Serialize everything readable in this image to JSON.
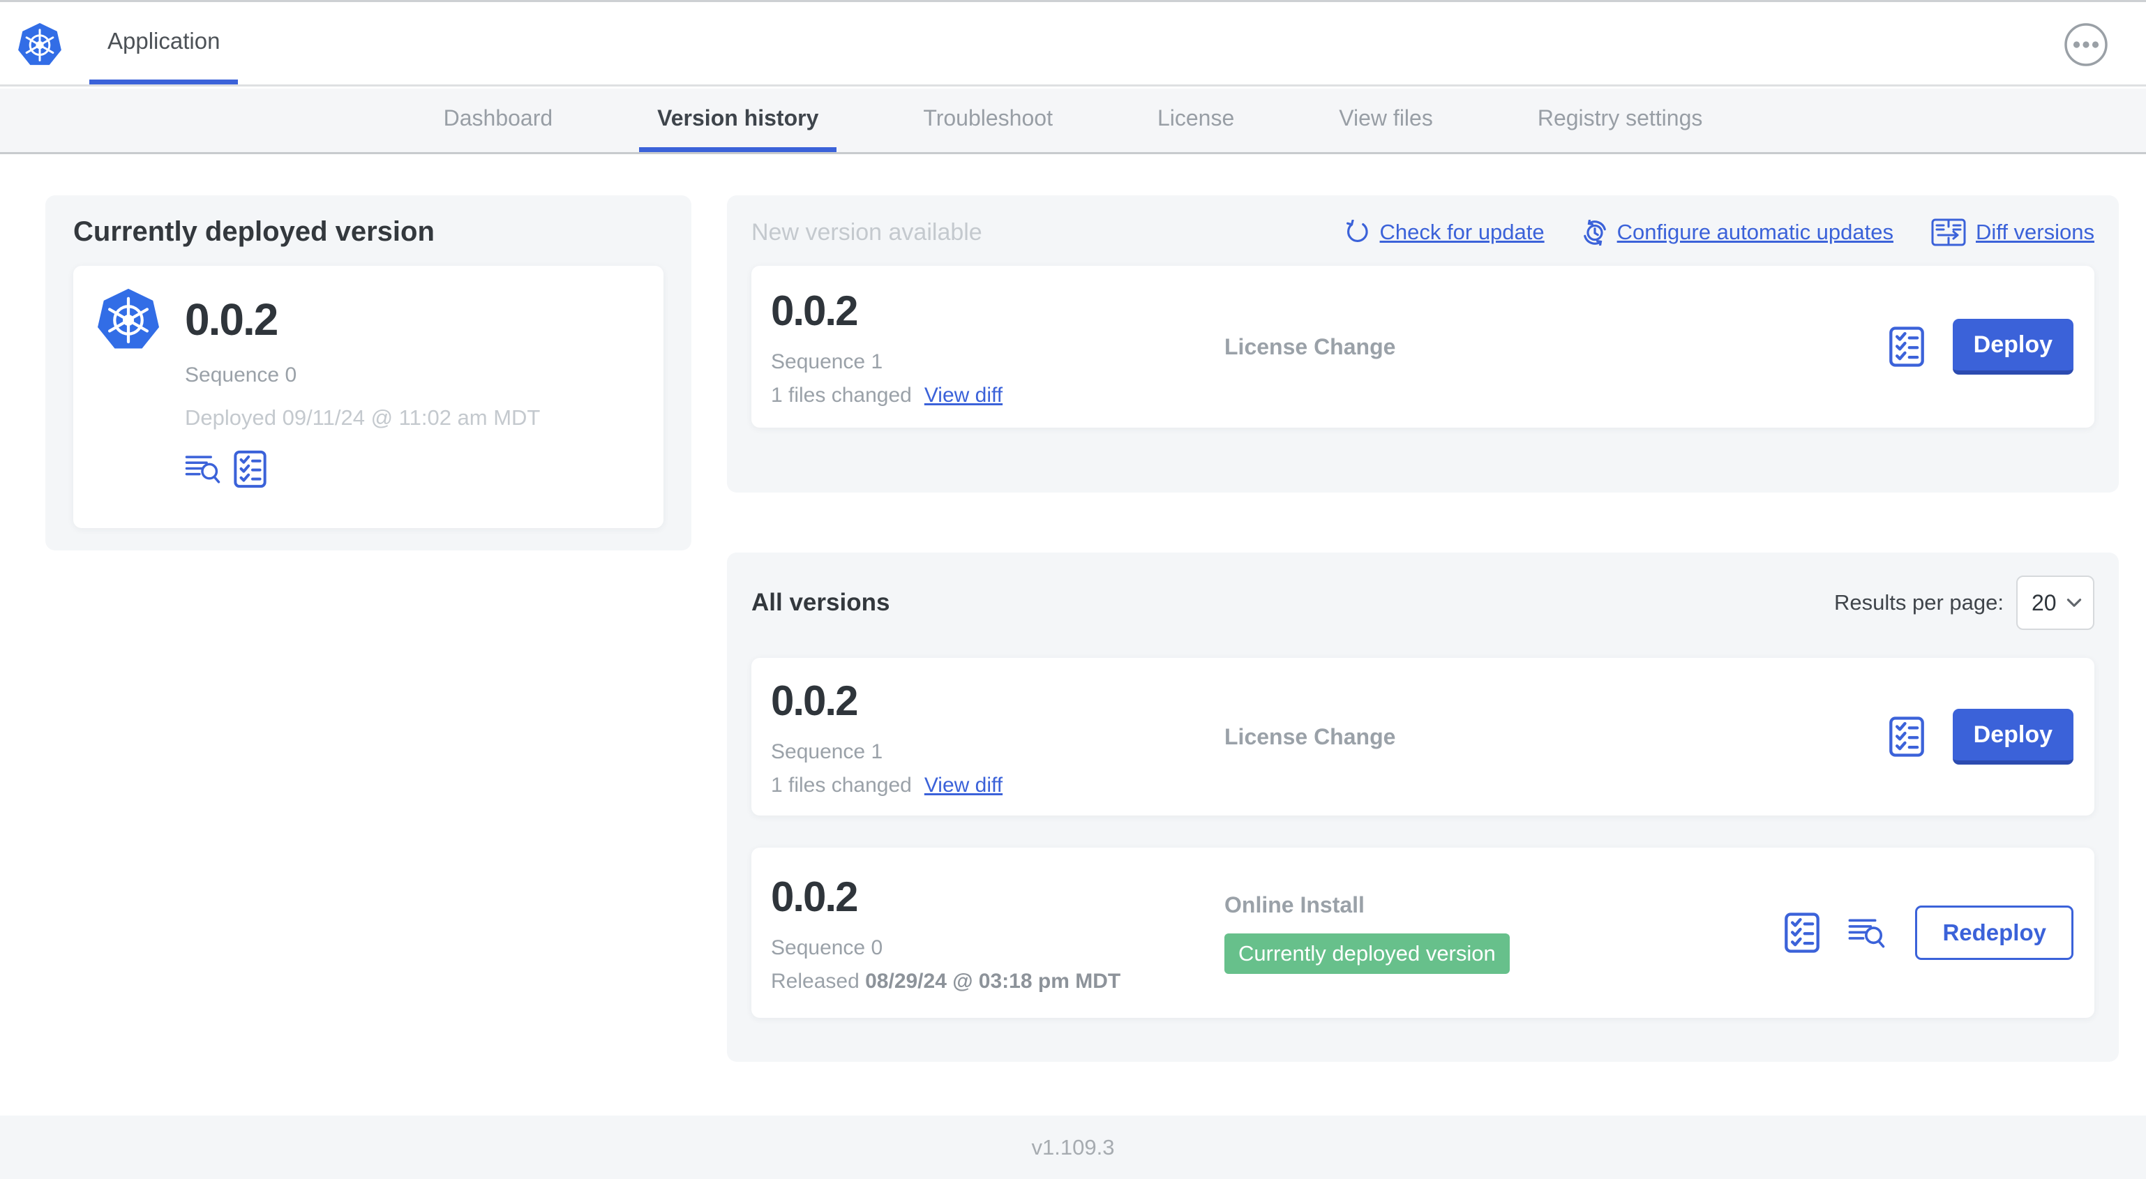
{
  "colors": {
    "accent": "#3b62d9",
    "accent_dark": "#2c4bb0",
    "kubernetes_blue": "#326de6",
    "badge_green": "#67c08b",
    "card_background": "#f4f6f8"
  },
  "header": {
    "title": "Application",
    "logo_icon": "kubernetes-logo",
    "menu_icon": "ellipsis-icon"
  },
  "nav": {
    "tabs": [
      {
        "label": "Dashboard",
        "active": false
      },
      {
        "label": "Version history",
        "active": true
      },
      {
        "label": "Troubleshoot",
        "active": false
      },
      {
        "label": "License",
        "active": false
      },
      {
        "label": "View files",
        "active": false
      },
      {
        "label": "Registry settings",
        "active": false
      }
    ]
  },
  "current_version": {
    "title": "Currently deployed version",
    "version": "0.0.2",
    "sequence": "Sequence 0",
    "deployed": "Deployed 09/11/24 @ 11:02 am MDT",
    "icons": [
      "logs-icon",
      "preflight-checklist-icon"
    ]
  },
  "new_version": {
    "title": "New version available",
    "actions": [
      {
        "icon": "refresh-icon",
        "label": "Check for update"
      },
      {
        "icon": "schedule-update-icon",
        "label": "Configure automatic updates"
      },
      {
        "icon": "diff-icon",
        "label": "Diff versions"
      }
    ],
    "row": {
      "version": "0.0.2",
      "sequence": "Sequence 1",
      "files_changed": "1 files changed",
      "view_diff": "View diff",
      "source": "License Change",
      "deploy_label": "Deploy"
    }
  },
  "all_versions": {
    "title": "All versions",
    "results_per_page_label": "Results per page:",
    "results_per_page_value": "20",
    "rows": [
      {
        "version": "0.0.2",
        "sequence": "Sequence 1",
        "files_changed": "1 files changed",
        "view_diff": "View diff",
        "source": "License Change",
        "deploy_label": "Deploy"
      },
      {
        "version": "0.0.2",
        "sequence": "Sequence 0",
        "released_prefix": "Released",
        "released_date": "08/29/24 @ 03:18 pm MDT",
        "source": "Online Install",
        "badge": "Currently deployed version",
        "redeploy_label": "Redeploy"
      }
    ]
  },
  "footer": {
    "app_version": "v1.109.3"
  }
}
